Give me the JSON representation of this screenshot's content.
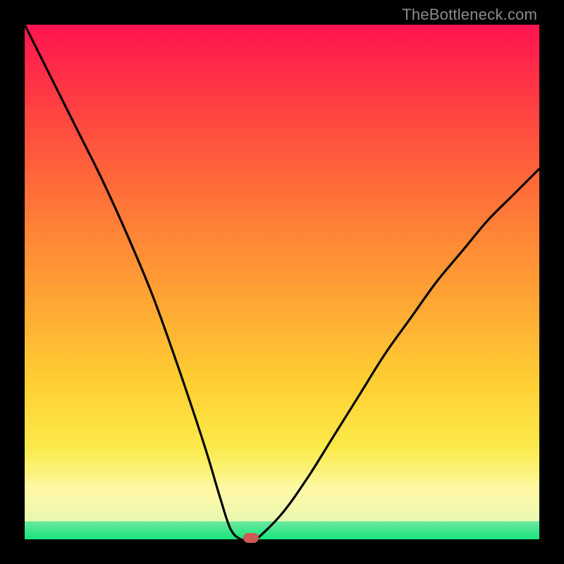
{
  "attribution": "TheBottleneck.com",
  "colors": {
    "top": "#ff1450",
    "mid_upper": "#ff8336",
    "mid_lower": "#ffd033",
    "pale": "#fdf89a",
    "green": "#17e57b",
    "curve": "#000000",
    "marker": "#cc5a52",
    "frame": "#000000",
    "attribution_text": "#8b8b8b"
  },
  "chart_data": {
    "type": "line",
    "title": "",
    "xlabel": "",
    "ylabel": "",
    "xlim": [
      0,
      100
    ],
    "ylim": [
      0,
      100
    ],
    "series": [
      {
        "name": "bottleneck-curve",
        "x": [
          0,
          5,
          10,
          15,
          20,
          25,
          30,
          35,
          38,
          40,
          42,
          44,
          45,
          50,
          55,
          60,
          65,
          70,
          75,
          80,
          85,
          90,
          95,
          100
        ],
        "y": [
          100,
          90,
          80,
          70,
          59,
          47,
          33,
          18,
          8,
          2,
          0,
          0,
          0,
          5,
          12,
          20,
          28,
          36,
          43,
          50,
          56,
          62,
          67,
          72
        ]
      }
    ],
    "marker": {
      "x": 44,
      "y": 0,
      "name": "optimal-point"
    },
    "background_gradient": {
      "orientation": "vertical",
      "stops": [
        {
          "pos": 0.0,
          "color": "#ff1450"
        },
        {
          "pos": 0.4,
          "color": "#ff8336"
        },
        {
          "pos": 0.7,
          "color": "#ffd033"
        },
        {
          "pos": 0.9,
          "color": "#fdf89a"
        },
        {
          "pos": 0.97,
          "color": "#6be8a0"
        },
        {
          "pos": 1.0,
          "color": "#17e57b"
        }
      ]
    }
  }
}
